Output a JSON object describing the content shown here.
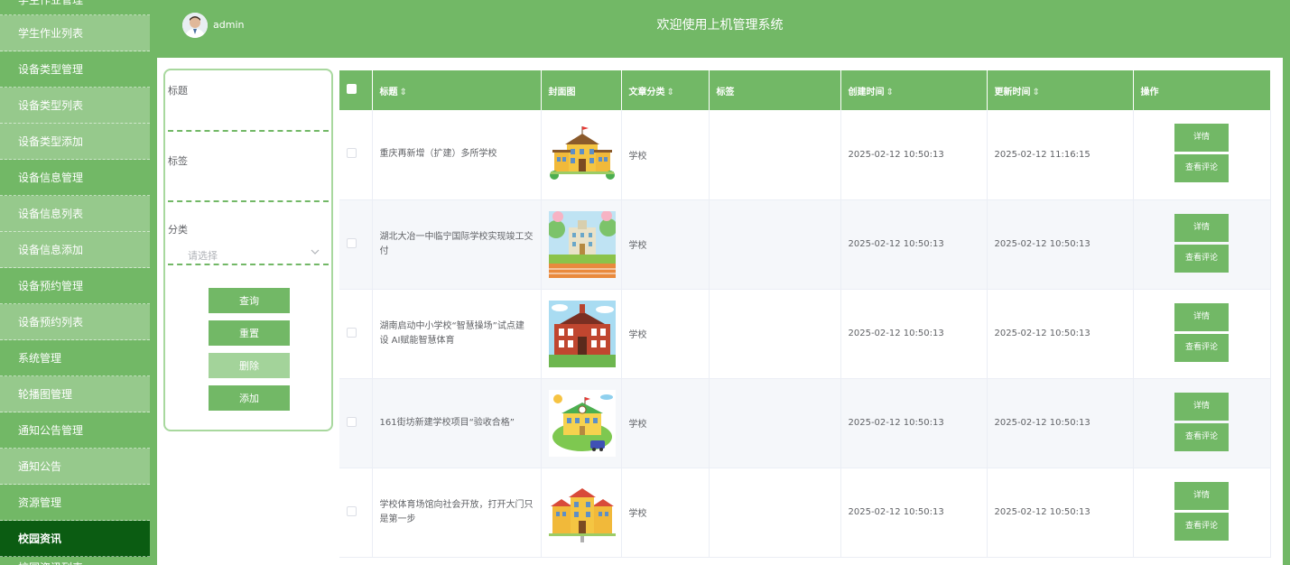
{
  "header": {
    "title": "欢迎使用上机管理系统",
    "user": "admin"
  },
  "sidebar": {
    "items": [
      {
        "label": "学生作业管理",
        "type": "partial-top"
      },
      {
        "label": "学生作业列表",
        "type": "sub"
      },
      {
        "label": "设备类型管理",
        "type": "group"
      },
      {
        "label": "设备类型列表",
        "type": "sub"
      },
      {
        "label": "设备类型添加",
        "type": "sub"
      },
      {
        "label": "设备信息管理",
        "type": "group"
      },
      {
        "label": "设备信息列表",
        "type": "sub"
      },
      {
        "label": "设备信息添加",
        "type": "sub"
      },
      {
        "label": "设备预约管理",
        "type": "group"
      },
      {
        "label": "设备预约列表",
        "type": "sub"
      },
      {
        "label": "系统管理",
        "type": "group"
      },
      {
        "label": "轮播图管理",
        "type": "sub"
      },
      {
        "label": "通知公告管理",
        "type": "group"
      },
      {
        "label": "通知公告",
        "type": "sub"
      },
      {
        "label": "资源管理",
        "type": "group"
      },
      {
        "label": "校园资讯",
        "type": "active"
      },
      {
        "label": "校园资讯列表",
        "type": "partial-bottom"
      }
    ]
  },
  "search": {
    "title_label": "标题",
    "title_value": "",
    "tag_label": "标签",
    "tag_value": "",
    "category_label": "分类",
    "category_placeholder": "请选择",
    "buttons": {
      "query": "查询",
      "reset": "重置",
      "delete": "删除",
      "add": "添加"
    }
  },
  "table": {
    "headers": {
      "title": "标题",
      "cover": "封面图",
      "category": "文章分类",
      "tag": "标签",
      "created": "创建时间",
      "updated": "更新时间",
      "actions": "操作"
    },
    "sort_icon": "⇕",
    "rows": [
      {
        "title": "重庆再新增（扩建）多所学校",
        "category": "学校",
        "tag": "",
        "created": "2025-02-12 10:50:13",
        "updated": "2025-02-12 11:16:15"
      },
      {
        "title": "湖北大冶一中临宁国际学校实现竣工交付",
        "category": "学校",
        "tag": "",
        "created": "2025-02-12 10:50:13",
        "updated": "2025-02-12 10:50:13"
      },
      {
        "title": "湖南启动中小学校“智慧操场”试点建设 AI赋能智慧体育",
        "category": "学校",
        "tag": "",
        "created": "2025-02-12 10:50:13",
        "updated": "2025-02-12 10:50:13"
      },
      {
        "title": "161街坊新建学校项目“验收合格”",
        "category": "学校",
        "tag": "",
        "created": "2025-02-12 10:50:13",
        "updated": "2025-02-12 10:50:13"
      },
      {
        "title": "学校体育场馆向社会开放，打开大门只是第一步",
        "category": "学校",
        "tag": "",
        "created": "2025-02-12 10:50:13",
        "updated": "2025-02-12 10:50:13"
      }
    ],
    "row_actions": {
      "detail": "详情",
      "comments": "查看评论"
    }
  },
  "colors": {
    "primary": "#72b866",
    "sidebar_sub": "#96c98c",
    "sidebar_active": "#0b5c12",
    "muted_button": "#a3d39a"
  }
}
